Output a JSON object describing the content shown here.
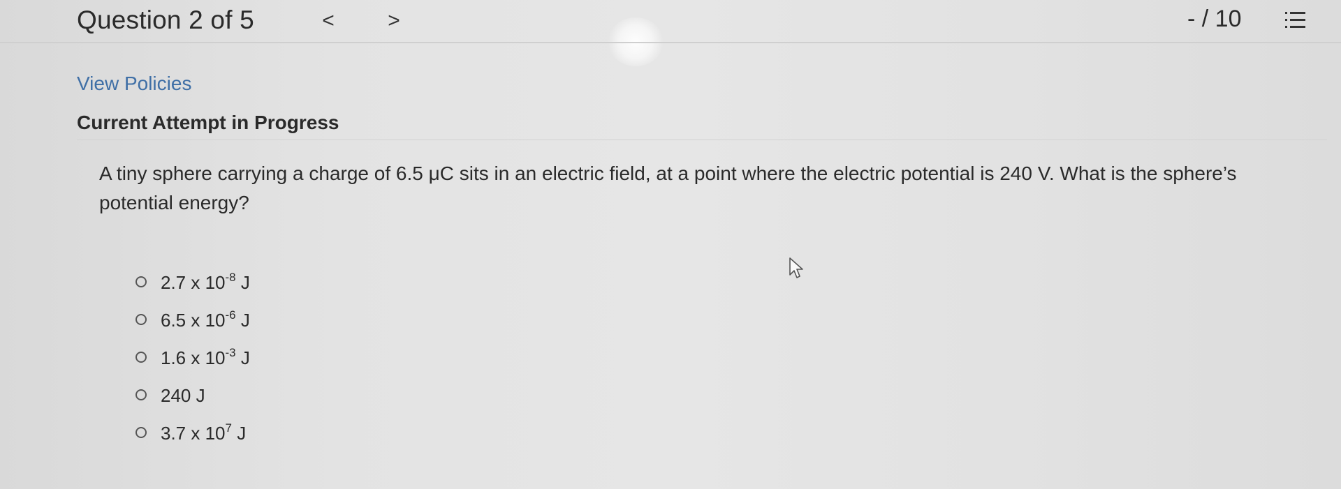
{
  "header": {
    "question_counter": "Question 2 of 5",
    "prev_label": "<",
    "next_label": ">",
    "score": "- / 10"
  },
  "links": {
    "view_policies": "View Policies"
  },
  "status": {
    "attempt": "Current Attempt in Progress"
  },
  "question": {
    "text": "A tiny sphere carrying a charge of 6.5 μC sits in an electric field, at a point where the electric potential is 240 V. What is the sphere’s potential energy?"
  },
  "options": [
    {
      "mantissa": "2.7 x 10",
      "exponent": "-8",
      "unit": " J"
    },
    {
      "mantissa": "6.5 x 10",
      "exponent": "-6",
      "unit": " J"
    },
    {
      "mantissa": "1.6 x 10",
      "exponent": "-3",
      "unit": " J"
    },
    {
      "mantissa": "240 J",
      "exponent": "",
      "unit": ""
    },
    {
      "mantissa": "3.7 x 10",
      "exponent": "7",
      "unit": " J"
    }
  ],
  "icons": {
    "prev": "chevron-left-icon",
    "next": "chevron-right-icon",
    "list": "list-icon",
    "cursor": "mouse-pointer-icon"
  },
  "colors": {
    "link": "#3f6fa6",
    "text": "#2a2a2a",
    "background": "#e3e3e3"
  }
}
